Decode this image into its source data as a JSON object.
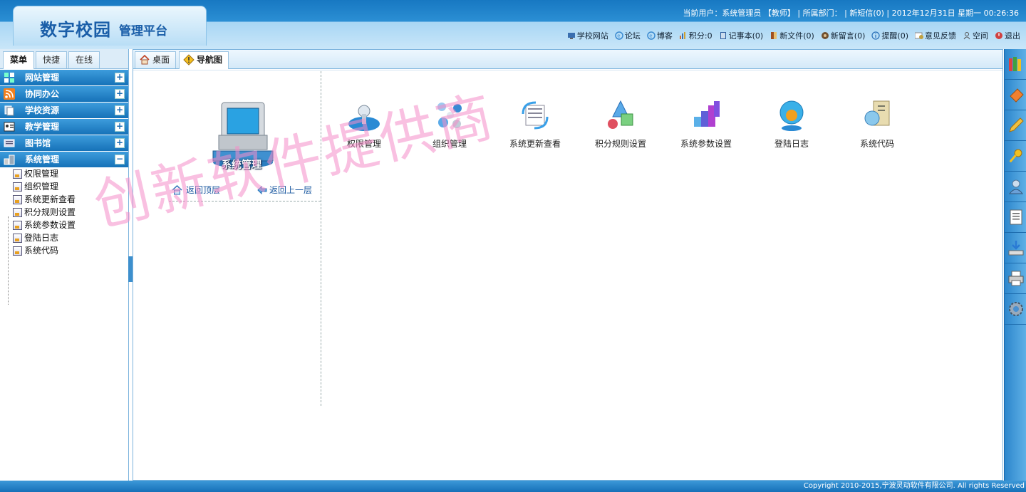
{
  "header": {
    "logo_main": "数字校园",
    "logo_sub": "管理平台",
    "user_info": "当前用户：系统管理员 【教师】 | 所属部门：  | 新短信(0) | 2012年12月31日 星期一 00:26:36",
    "links": [
      {
        "label": "学校网站",
        "icon": "school-site-icon",
        "color": "#3a6fb0"
      },
      {
        "label": "论坛",
        "icon": "forum-icon",
        "color": "#3a8ad0"
      },
      {
        "label": "博客",
        "icon": "blog-icon",
        "color": "#3a8ad0"
      },
      {
        "label": "积分:0",
        "icon": "points-icon",
        "color": "#d07030"
      },
      {
        "label": "记事本(0)",
        "icon": "notebook-icon",
        "color": "#2f5fa0"
      },
      {
        "label": "新文件(0)",
        "icon": "new-file-icon",
        "color": "#a05020"
      },
      {
        "label": "新留言(0)",
        "icon": "new-message-icon",
        "color": "#705030"
      },
      {
        "label": "提醒(0)",
        "icon": "reminder-icon",
        "color": "#2a70b8"
      },
      {
        "label": "意见反馈",
        "icon": "feedback-icon",
        "color": "#c0a040"
      },
      {
        "label": "空间",
        "icon": "space-icon",
        "color": "#555"
      },
      {
        "label": "退出",
        "icon": "logout-icon",
        "color": "#d04040"
      }
    ]
  },
  "left": {
    "tabs": [
      "菜单",
      "快捷",
      "在线"
    ],
    "menus": [
      {
        "label": "网站管理",
        "icon": "website-icon",
        "toggle": "+"
      },
      {
        "label": "协同办公",
        "icon": "rss-office-icon",
        "toggle": "+"
      },
      {
        "label": "学校资源",
        "icon": "resources-icon",
        "toggle": "+"
      },
      {
        "label": "教学管理",
        "icon": "teaching-icon",
        "toggle": "+"
      },
      {
        "label": "图书馆",
        "icon": "library-icon",
        "toggle": "+"
      },
      {
        "label": "系统管理",
        "icon": "system-icon",
        "toggle": "−"
      }
    ],
    "sub_items": [
      "权限管理",
      "组织管理",
      "系统更新查看",
      "积分规则设置",
      "系统参数设置",
      "登陆日志",
      "系统代码"
    ]
  },
  "main": {
    "tabs": [
      {
        "label": "桌面",
        "icon": "home-icon"
      },
      {
        "label": "导航图",
        "icon": "navigation-map-icon"
      }
    ],
    "section_label": "系统管理",
    "back_top": "返回顶层",
    "back_up": "返回上一层",
    "functions": [
      {
        "label": "权限管理",
        "icon": "permission-icon"
      },
      {
        "label": "组织管理",
        "icon": "organization-icon"
      },
      {
        "label": "系统更新查看",
        "icon": "system-update-icon"
      },
      {
        "label": "积分规则设置",
        "icon": "points-rule-icon"
      },
      {
        "label": "系统参数设置",
        "icon": "system-params-icon"
      },
      {
        "label": "登陆日志",
        "icon": "login-log-icon"
      },
      {
        "label": "系统代码",
        "icon": "system-code-icon"
      }
    ]
  },
  "watermark": "创新软件提供商",
  "right_bar": [
    "books-icon",
    "eraser-icon",
    "pencil-icon",
    "key-icon",
    "user-icon",
    "notes-icon",
    "download-icon",
    "printer-icon",
    "settings-icon"
  ],
  "footer": "Copyright 2010-2015,宁波灵动软件有限公司. All rights Reserved"
}
